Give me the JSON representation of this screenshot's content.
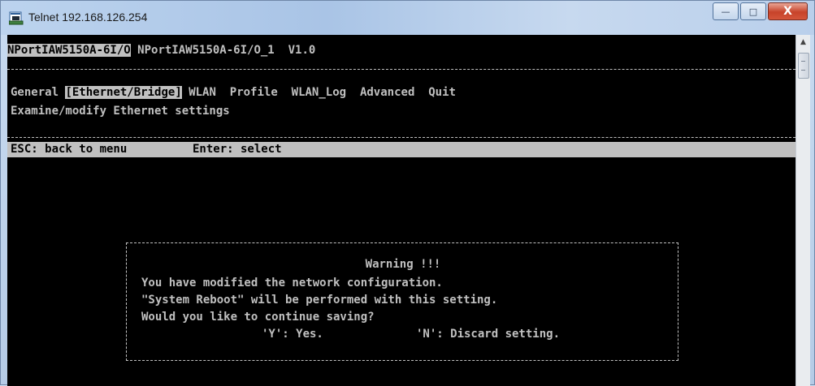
{
  "window": {
    "title": "Telnet 192.168.126.254",
    "buttons": {
      "minimize": "—",
      "maximize": "□",
      "close": "X"
    }
  },
  "header": {
    "device_selected": "NPortIAW5150A-6I/O",
    "device_name": "NPortIAW5150A-6I/O_1",
    "version": "V1.0"
  },
  "menu": {
    "items": [
      {
        "label": "General",
        "selected": false
      },
      {
        "label": "[Ethernet/Bridge]",
        "selected": true
      },
      {
        "label": "WLAN",
        "selected": false
      },
      {
        "label": "Profile",
        "selected": false
      },
      {
        "label": "WLAN_Log",
        "selected": false
      },
      {
        "label": "Advanced",
        "selected": false
      },
      {
        "label": "Quit",
        "selected": false
      }
    ],
    "description": "Examine/modify Ethernet settings"
  },
  "status": {
    "esc_hint": "ESC: back to menu",
    "enter_hint": "Enter: select"
  },
  "dialog": {
    "title": "Warning !!!",
    "lines": [
      "You have modified the network configuration.",
      "\"System Reboot\" will be performed with this setting.",
      "Would you like to continue saving?"
    ],
    "option_yes": "'Y': Yes.",
    "option_no": "'N': Discard setting."
  },
  "colors": {
    "console_bg": "#000000",
    "console_fg": "#c0c0c0",
    "highlight_bg": "#c0c0c0",
    "highlight_fg": "#000000"
  }
}
